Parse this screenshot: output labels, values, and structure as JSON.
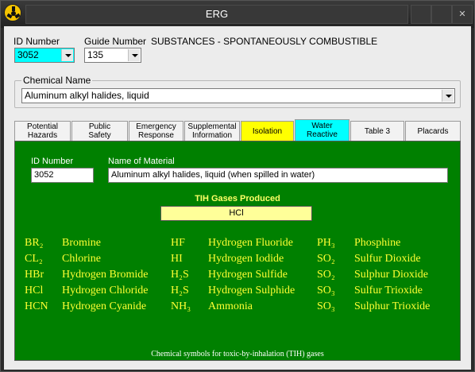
{
  "window": {
    "title": "ERG",
    "controls": [
      "",
      "",
      "✕"
    ]
  },
  "form": {
    "id_number_label": "ID Number",
    "id_number_value": "3052",
    "guide_number_label": "Guide Number",
    "guide_number_value": "135",
    "guide_title": "SUBSTANCES - SPONTANEOUSLY COMBUSTIBLE",
    "chemical_name_label": "Chemical Name",
    "chemical_name_value": "Aluminum alkyl halides, liquid"
  },
  "tabs": [
    {
      "label_line1": "Potential",
      "label_line2": "Hazards",
      "selected": false,
      "color": "#f2f2f2"
    },
    {
      "label_line1": "Public",
      "label_line2": "Safety",
      "selected": false,
      "color": "#f2f2f2"
    },
    {
      "label_line1": "Emergency",
      "label_line2": "Response",
      "selected": false,
      "color": "#f2f2f2"
    },
    {
      "label_line1": "Supplemental",
      "label_line2": "Information",
      "selected": false,
      "color": "#f2f2f2"
    },
    {
      "label_line1": "Isolation",
      "label_line2": "",
      "selected": false,
      "color": "#ffff00"
    },
    {
      "label_line1": "Water",
      "label_line2": "Reactive",
      "selected": true,
      "color": "#00ffff"
    },
    {
      "label_line1": "Table 3",
      "label_line2": "",
      "selected": false,
      "color": "#f2f2f2"
    },
    {
      "label_line1": "Placards",
      "label_line2": "",
      "selected": false,
      "color": "#f2f2f2"
    }
  ],
  "panel": {
    "id_label": "ID Number",
    "id_value": "3052",
    "name_label": "Name of Material",
    "name_value": "Aluminum alkyl halides, liquid (when spilled in water)",
    "tih_title": "TIH Gases Produced",
    "tih_value": "HCl",
    "gases": [
      [
        {
          "symbol": "BR₂",
          "name": "Bromine"
        },
        {
          "symbol": "CL₂",
          "name": "Chlorine"
        },
        {
          "symbol": "HBr",
          "name": "Hydrogen Bromide"
        },
        {
          "symbol": "HCl",
          "name": "Hydrogen Chloride"
        },
        {
          "symbol": "HCN",
          "name": "Hydrogen Cyanide"
        }
      ],
      [
        {
          "symbol": "HF",
          "name": "Hydrogen Fluoride"
        },
        {
          "symbol": "HI",
          "name": "Hydrogen Iodide"
        },
        {
          "symbol": "H₂S",
          "name": "Hydrogen Sulfide"
        },
        {
          "symbol": "H₂S",
          "name": "Hydrogen Sulphide"
        },
        {
          "symbol": "NH₃",
          "name": "Ammonia"
        }
      ],
      [
        {
          "symbol": "PH₃",
          "name": "Phosphine"
        },
        {
          "symbol": "SO₂",
          "name": "Sulfur Dioxide"
        },
        {
          "symbol": "SO₂",
          "name": "Sulphur Dioxide"
        },
        {
          "symbol": "SO₃",
          "name": "Sulfur Trioxide"
        },
        {
          "symbol": "SO₃",
          "name": "Sulphur Trioxide"
        }
      ]
    ],
    "footnote": "Chemical symbols for toxic-by-inhalation (TIH) gases"
  },
  "colors": {
    "panel_bg": "#008000",
    "gas_text": "#ffff33",
    "id_highlight": "#00ffff",
    "tih_box": "#ffff99"
  }
}
